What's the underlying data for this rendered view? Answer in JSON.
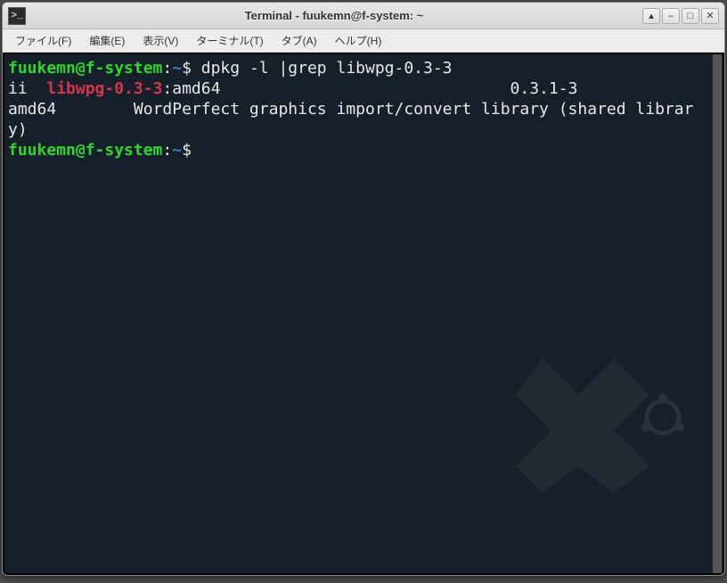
{
  "window": {
    "title": "Terminal - fuukemn@f-system: ~"
  },
  "menu": {
    "file": "ファイル(F)",
    "edit": "編集(E)",
    "view": "表示(V)",
    "terminal": "ターミナル(T)",
    "tabs": "タブ(A)",
    "help": "ヘルプ(H)"
  },
  "prompt": {
    "userhost": "fuukemn@f-system",
    "sep": ":",
    "path": "~",
    "sigil": "$"
  },
  "cmd": {
    "text": " dpkg -l |grep libwpg-0.3-3"
  },
  "output": {
    "status": "ii  ",
    "pkg": "libwpg-0.3-3",
    "arch_suffix": ":amd64",
    "version": "0.3.1-3",
    "arch": "amd64",
    "desc": "WordPerfect graphics import/convert library (shared library)"
  }
}
